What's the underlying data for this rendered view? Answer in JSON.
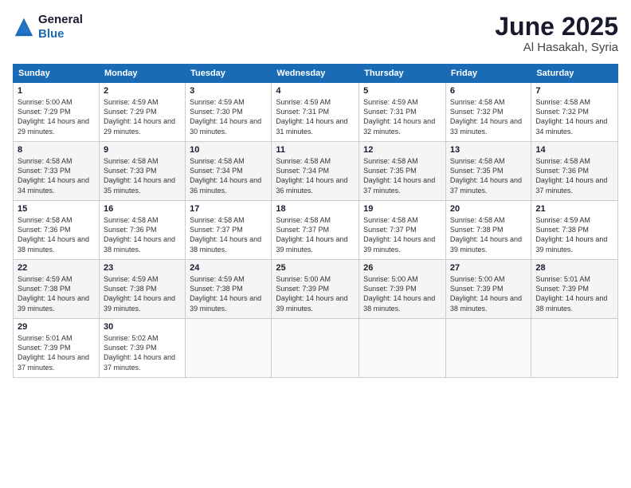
{
  "logo": {
    "line1": "General",
    "line2": "Blue"
  },
  "title": "June 2025",
  "location": "Al Hasakah, Syria",
  "headers": [
    "Sunday",
    "Monday",
    "Tuesday",
    "Wednesday",
    "Thursday",
    "Friday",
    "Saturday"
  ],
  "weeks": [
    [
      {
        "day": "1",
        "sunrise": "5:00 AM",
        "sunset": "7:29 PM",
        "daylight": "14 hours and 29 minutes."
      },
      {
        "day": "2",
        "sunrise": "4:59 AM",
        "sunset": "7:29 PM",
        "daylight": "14 hours and 29 minutes."
      },
      {
        "day": "3",
        "sunrise": "4:59 AM",
        "sunset": "7:30 PM",
        "daylight": "14 hours and 30 minutes."
      },
      {
        "day": "4",
        "sunrise": "4:59 AM",
        "sunset": "7:31 PM",
        "daylight": "14 hours and 31 minutes."
      },
      {
        "day": "5",
        "sunrise": "4:59 AM",
        "sunset": "7:31 PM",
        "daylight": "14 hours and 32 minutes."
      },
      {
        "day": "6",
        "sunrise": "4:58 AM",
        "sunset": "7:32 PM",
        "daylight": "14 hours and 33 minutes."
      },
      {
        "day": "7",
        "sunrise": "4:58 AM",
        "sunset": "7:32 PM",
        "daylight": "14 hours and 34 minutes."
      }
    ],
    [
      {
        "day": "8",
        "sunrise": "4:58 AM",
        "sunset": "7:33 PM",
        "daylight": "14 hours and 34 minutes."
      },
      {
        "day": "9",
        "sunrise": "4:58 AM",
        "sunset": "7:33 PM",
        "daylight": "14 hours and 35 minutes."
      },
      {
        "day": "10",
        "sunrise": "4:58 AM",
        "sunset": "7:34 PM",
        "daylight": "14 hours and 36 minutes."
      },
      {
        "day": "11",
        "sunrise": "4:58 AM",
        "sunset": "7:34 PM",
        "daylight": "14 hours and 36 minutes."
      },
      {
        "day": "12",
        "sunrise": "4:58 AM",
        "sunset": "7:35 PM",
        "daylight": "14 hours and 37 minutes."
      },
      {
        "day": "13",
        "sunrise": "4:58 AM",
        "sunset": "7:35 PM",
        "daylight": "14 hours and 37 minutes."
      },
      {
        "day": "14",
        "sunrise": "4:58 AM",
        "sunset": "7:36 PM",
        "daylight": "14 hours and 37 minutes."
      }
    ],
    [
      {
        "day": "15",
        "sunrise": "4:58 AM",
        "sunset": "7:36 PM",
        "daylight": "14 hours and 38 minutes."
      },
      {
        "day": "16",
        "sunrise": "4:58 AM",
        "sunset": "7:36 PM",
        "daylight": "14 hours and 38 minutes."
      },
      {
        "day": "17",
        "sunrise": "4:58 AM",
        "sunset": "7:37 PM",
        "daylight": "14 hours and 38 minutes."
      },
      {
        "day": "18",
        "sunrise": "4:58 AM",
        "sunset": "7:37 PM",
        "daylight": "14 hours and 39 minutes."
      },
      {
        "day": "19",
        "sunrise": "4:58 AM",
        "sunset": "7:37 PM",
        "daylight": "14 hours and 39 minutes."
      },
      {
        "day": "20",
        "sunrise": "4:58 AM",
        "sunset": "7:38 PM",
        "daylight": "14 hours and 39 minutes."
      },
      {
        "day": "21",
        "sunrise": "4:59 AM",
        "sunset": "7:38 PM",
        "daylight": "14 hours and 39 minutes."
      }
    ],
    [
      {
        "day": "22",
        "sunrise": "4:59 AM",
        "sunset": "7:38 PM",
        "daylight": "14 hours and 39 minutes."
      },
      {
        "day": "23",
        "sunrise": "4:59 AM",
        "sunset": "7:38 PM",
        "daylight": "14 hours and 39 minutes."
      },
      {
        "day": "24",
        "sunrise": "4:59 AM",
        "sunset": "7:38 PM",
        "daylight": "14 hours and 39 minutes."
      },
      {
        "day": "25",
        "sunrise": "5:00 AM",
        "sunset": "7:39 PM",
        "daylight": "14 hours and 39 minutes."
      },
      {
        "day": "26",
        "sunrise": "5:00 AM",
        "sunset": "7:39 PM",
        "daylight": "14 hours and 38 minutes."
      },
      {
        "day": "27",
        "sunrise": "5:00 AM",
        "sunset": "7:39 PM",
        "daylight": "14 hours and 38 minutes."
      },
      {
        "day": "28",
        "sunrise": "5:01 AM",
        "sunset": "7:39 PM",
        "daylight": "14 hours and 38 minutes."
      }
    ],
    [
      {
        "day": "29",
        "sunrise": "5:01 AM",
        "sunset": "7:39 PM",
        "daylight": "14 hours and 37 minutes."
      },
      {
        "day": "30",
        "sunrise": "5:02 AM",
        "sunset": "7:39 PM",
        "daylight": "14 hours and 37 minutes."
      },
      null,
      null,
      null,
      null,
      null
    ]
  ]
}
